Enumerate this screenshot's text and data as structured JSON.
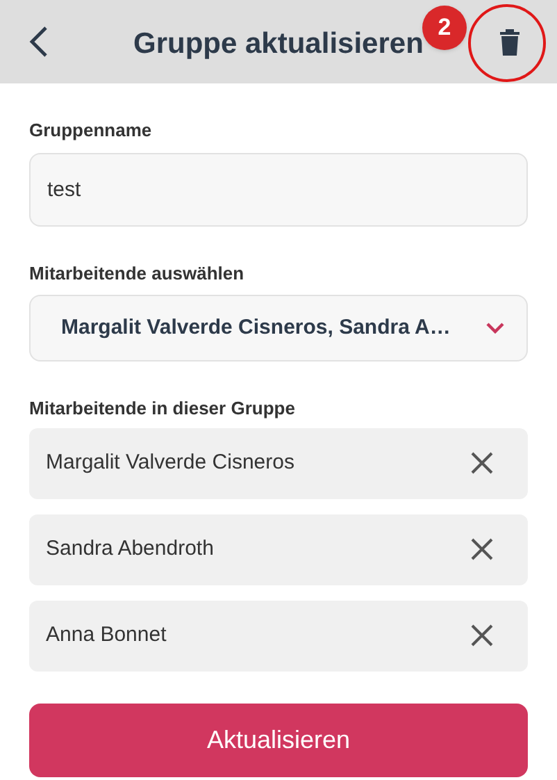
{
  "header": {
    "title": "Gruppe aktualisieren",
    "annotation": {
      "label": "2"
    }
  },
  "group_name": {
    "label": "Gruppenname",
    "value": "test"
  },
  "employee_select": {
    "label": "Mitarbeitende auswählen",
    "value": "Margalit Valverde Cisneros, Sandra A…"
  },
  "members": {
    "label": "Mitarbeitende in dieser Gruppe",
    "items": [
      {
        "name": "Margalit Valverde Cisneros"
      },
      {
        "name": "Sandra Abendroth"
      },
      {
        "name": "Anna Bonnet"
      }
    ]
  },
  "submit_button": "Aktualisieren"
}
